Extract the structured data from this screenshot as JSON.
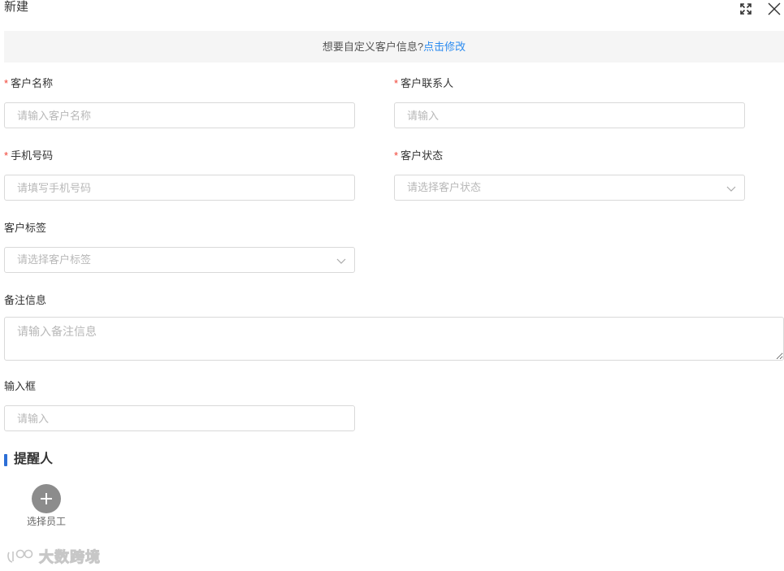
{
  "dialog": {
    "title": "新建"
  },
  "notice": {
    "text": "想要自定义客户信息?",
    "link": "点击修改"
  },
  "form": {
    "required_mark": "*",
    "customer_name": {
      "label": "客户名称",
      "placeholder": "请输入客户名称"
    },
    "contact": {
      "label": "客户联系人",
      "placeholder": "请输入"
    },
    "phone": {
      "label": "手机号码",
      "placeholder": "请填写手机号码"
    },
    "status": {
      "label": "客户状态",
      "placeholder": "请选择客户状态"
    },
    "tags": {
      "label": "客户标签",
      "placeholder": "请选择客户标签"
    },
    "remark": {
      "label": "备注信息",
      "placeholder": "请输入备注信息"
    },
    "input_box": {
      "label": "输入框",
      "placeholder": "请输入"
    }
  },
  "reminder": {
    "section_title": "提醒人",
    "add_label": "选择员工"
  },
  "watermark": {
    "text": "大数跨境"
  },
  "colors": {
    "accent": "#2d6fd6",
    "link": "#2d8cf0",
    "required": "#f04134"
  }
}
